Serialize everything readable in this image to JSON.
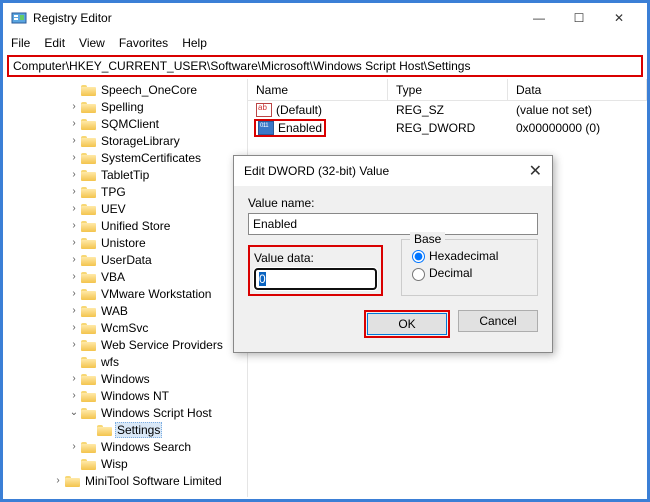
{
  "window": {
    "title": "Registry Editor"
  },
  "menu": {
    "file": "File",
    "edit": "Edit",
    "view": "View",
    "favorites": "Favorites",
    "help": "Help"
  },
  "address": "Computer\\HKEY_CURRENT_USER\\Software\\Microsoft\\Windows Script Host\\Settings",
  "tree": [
    {
      "indent": 4,
      "twisty": "",
      "label": "Speech_OneCore"
    },
    {
      "indent": 4,
      "twisty": ">",
      "label": "Spelling"
    },
    {
      "indent": 4,
      "twisty": ">",
      "label": "SQMClient"
    },
    {
      "indent": 4,
      "twisty": ">",
      "label": "StorageLibrary"
    },
    {
      "indent": 4,
      "twisty": ">",
      "label": "SystemCertificates"
    },
    {
      "indent": 4,
      "twisty": ">",
      "label": "TabletTip"
    },
    {
      "indent": 4,
      "twisty": ">",
      "label": "TPG"
    },
    {
      "indent": 4,
      "twisty": ">",
      "label": "UEV"
    },
    {
      "indent": 4,
      "twisty": ">",
      "label": "Unified Store"
    },
    {
      "indent": 4,
      "twisty": ">",
      "label": "Unistore"
    },
    {
      "indent": 4,
      "twisty": ">",
      "label": "UserData"
    },
    {
      "indent": 4,
      "twisty": ">",
      "label": "VBA"
    },
    {
      "indent": 4,
      "twisty": ">",
      "label": "VMware Workstation"
    },
    {
      "indent": 4,
      "twisty": ">",
      "label": "WAB"
    },
    {
      "indent": 4,
      "twisty": ">",
      "label": "WcmSvc"
    },
    {
      "indent": 4,
      "twisty": ">",
      "label": "Web Service Providers"
    },
    {
      "indent": 4,
      "twisty": "",
      "label": "wfs"
    },
    {
      "indent": 4,
      "twisty": ">",
      "label": "Windows"
    },
    {
      "indent": 4,
      "twisty": ">",
      "label": "Windows NT"
    },
    {
      "indent": 4,
      "twisty": "v",
      "label": "Windows Script Host"
    },
    {
      "indent": 5,
      "twisty": "",
      "label": "Settings",
      "selected": true
    },
    {
      "indent": 4,
      "twisty": ">",
      "label": "Windows Search"
    },
    {
      "indent": 4,
      "twisty": "",
      "label": "Wisp"
    },
    {
      "indent": 3,
      "twisty": ">",
      "label": "MiniTool Software Limited"
    }
  ],
  "list": {
    "headers": {
      "name": "Name",
      "type": "Type",
      "data": "Data"
    },
    "rows": [
      {
        "icon": "str",
        "name": "(Default)",
        "type": "REG_SZ",
        "data": "(value not set)",
        "hl": false
      },
      {
        "icon": "dw",
        "name": "Enabled",
        "type": "REG_DWORD",
        "data": "0x00000000 (0)",
        "hl": true
      }
    ]
  },
  "dialog": {
    "title": "Edit DWORD (32-bit) Value",
    "value_name_label": "Value name:",
    "value_name": "Enabled",
    "value_data_label": "Value data:",
    "value_data": "0",
    "base_label": "Base",
    "hex": "Hexadecimal",
    "dec": "Decimal",
    "ok": "OK",
    "cancel": "Cancel"
  }
}
